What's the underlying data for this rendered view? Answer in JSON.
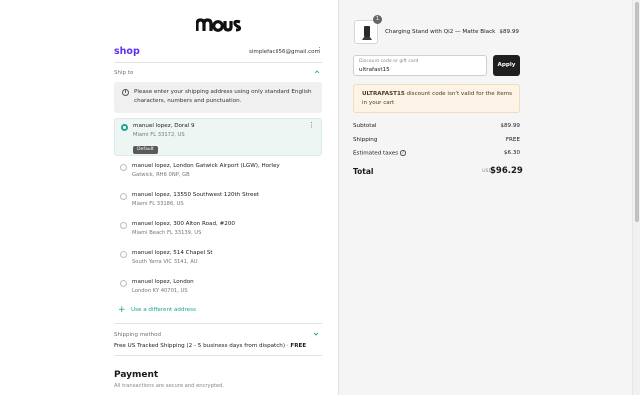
{
  "brand": {
    "logo_text": "mo",
    "accent": "#5a31f4",
    "teal": "#1aa38e"
  },
  "account": {
    "shop_label": "shop",
    "email": "simplefacil56@gmail.com"
  },
  "ship_to": {
    "label": "Ship to"
  },
  "notice": {
    "icon": "info-icon",
    "text": "Please enter your shipping address using only standard English characters, numbers and punctuation."
  },
  "addresses": [
    {
      "line1": "manuel lopez, Doral 9",
      "line2": "Miami FL 33172, US",
      "selected": true,
      "badge": "Default"
    },
    {
      "line1": "manuel lopez, London Gatwick Airport (LGW), Horley",
      "line2": "Gatwick, RH6 0NP, GB",
      "selected": false
    },
    {
      "line1": "manuel lopez, 13550 Southwest 120th Street",
      "line2": "Miami FL 33186, US",
      "selected": false
    },
    {
      "line1": "manuel lopez, 300 Alton Road, #200",
      "line2": "Miami Beach FL 33139, US",
      "selected": false
    },
    {
      "line1": "manuel lopez, 514 Chapel St",
      "line2": "South Yarra VIC 3141, AU",
      "selected": false
    },
    {
      "line1": "manuel lopez, London",
      "line2": "London KY 40701, US",
      "selected": false
    }
  ],
  "use_different": {
    "label": "Use a different address"
  },
  "shipping_method": {
    "label": "Shipping method",
    "value": "Free US Tracked Shipping (2 - 5 business days from dispatch) ·",
    "price": "FREE"
  },
  "payment": {
    "title": "Payment",
    "subtitle": "All transactions are secure and encrypted."
  },
  "cart": {
    "qty": "1",
    "product_name": "Charging Stand with Qi2 — Matte Black",
    "product_price": "$89.99"
  },
  "discount": {
    "placeholder": "Discount code or gift card",
    "value": "ultrafast15",
    "apply_label": "Apply"
  },
  "warning": {
    "code": "ULTRAFAST15",
    "text": " discount code isn't valid for the items in your cart"
  },
  "summary": {
    "subtotal_label": "Subtotal",
    "subtotal": "$89.99",
    "shipping_label": "Shipping",
    "shipping": "FREE",
    "taxes_label": "Estimated taxes",
    "taxes": "$6.30",
    "total_label": "Total",
    "currency": "USD",
    "total": "$96.29"
  }
}
